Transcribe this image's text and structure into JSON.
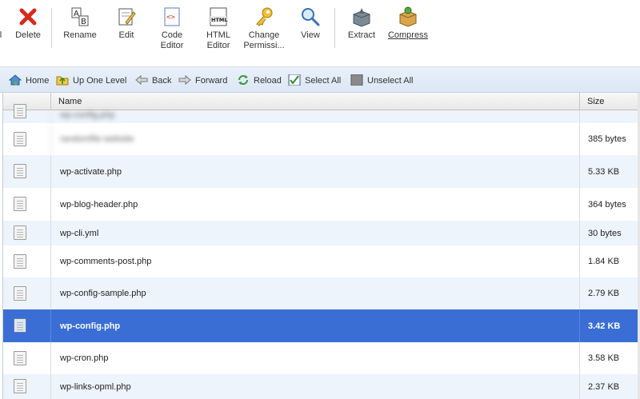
{
  "toolbar": {
    "buttons": [
      {
        "label": "Delete",
        "icon": "delete-icon"
      },
      {
        "label": "Rename",
        "icon": "rename-icon"
      },
      {
        "label": "Edit",
        "icon": "edit-icon"
      },
      {
        "label": "Code\nEditor",
        "icon": "code-editor-icon"
      },
      {
        "label": "HTML\nEditor",
        "icon": "html-editor-icon"
      },
      {
        "label": "Change\nPermissi...",
        "icon": "key-icon"
      },
      {
        "label": "View",
        "icon": "magnifier-icon"
      },
      {
        "label": "Extract",
        "icon": "extract-box-icon"
      },
      {
        "label": "Compress",
        "icon": "compress-box-icon"
      }
    ]
  },
  "nav": {
    "home": "Home",
    "up": "Up One Level",
    "back": "Back",
    "forward": "Forward",
    "reload": "Reload",
    "select_all": "Select All",
    "unselect_all": "Unselect All"
  },
  "table": {
    "columns": {
      "name": "Name",
      "size": "Size"
    },
    "rows": [
      {
        "name": "wp-config.php",
        "size": "",
        "blurred": true
      },
      {
        "name": "randomfile-website",
        "size": "385 bytes",
        "blurred": true
      },
      {
        "name": "wp-activate.php",
        "size": "5.33 KB"
      },
      {
        "name": "wp-blog-header.php",
        "size": "364 bytes"
      },
      {
        "name": "wp-cli.yml",
        "size": "30 bytes"
      },
      {
        "name": "wp-comments-post.php",
        "size": "1.84 KB"
      },
      {
        "name": "wp-config-sample.php",
        "size": "2.79 KB"
      },
      {
        "name": "wp-config.php",
        "size": "3.42 KB",
        "selected": true
      },
      {
        "name": "wp-cron.php",
        "size": "3.58 KB"
      },
      {
        "name": "wp-links-opml.php",
        "size": "2.37 KB"
      }
    ]
  },
  "colors": {
    "selected_row": "#3a6ed4",
    "alt_row": "#eef4fb",
    "navbar": "#dbe7f4"
  }
}
